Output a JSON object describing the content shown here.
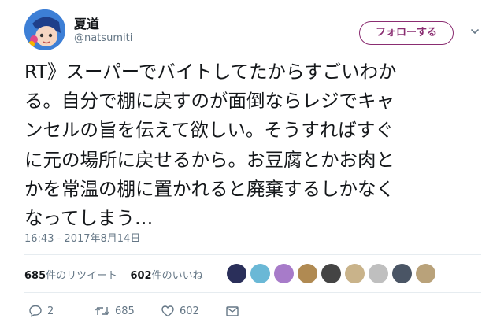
{
  "header": {
    "display_name": "夏道",
    "handle": "@natsumiti",
    "follow_label": "フォローする"
  },
  "tweet": {
    "lines": [
      "RT》スーパーでバイトしてたからすごいわか",
      "る。自分で棚に戻すのが面倒ならレジでキャ",
      "ンセルの旨を伝えて欲しい。そうすればすぐ",
      "に元の場所に戻せるから。お豆腐とかお肉と",
      "かを常温の棚に置かれると廃棄するしかなく",
      "なってしまう…"
    ],
    "timestamp": "16:43 - 2017年8月14日"
  },
  "stats": {
    "retweet_count": "685",
    "retweet_label": "件のリツイート",
    "like_count": "602",
    "like_label": "件のいいね"
  },
  "likers": [
    {
      "color": "#2a2f5a"
    },
    {
      "color": "#6ab8d6"
    },
    {
      "color": "#a77bc9"
    },
    {
      "color": "#b08a52"
    },
    {
      "color": "#444444"
    },
    {
      "color": "#c9b38a"
    },
    {
      "color": "#bfbfbf"
    },
    {
      "color": "#4a5565"
    },
    {
      "color": "#b9a27a"
    }
  ],
  "actions": {
    "reply_count": "2",
    "retweet_count": "685",
    "like_count": "602"
  },
  "colors": {
    "accent": "#8a2d71",
    "secondary_text": "#657786",
    "border": "#e6ecf0"
  }
}
